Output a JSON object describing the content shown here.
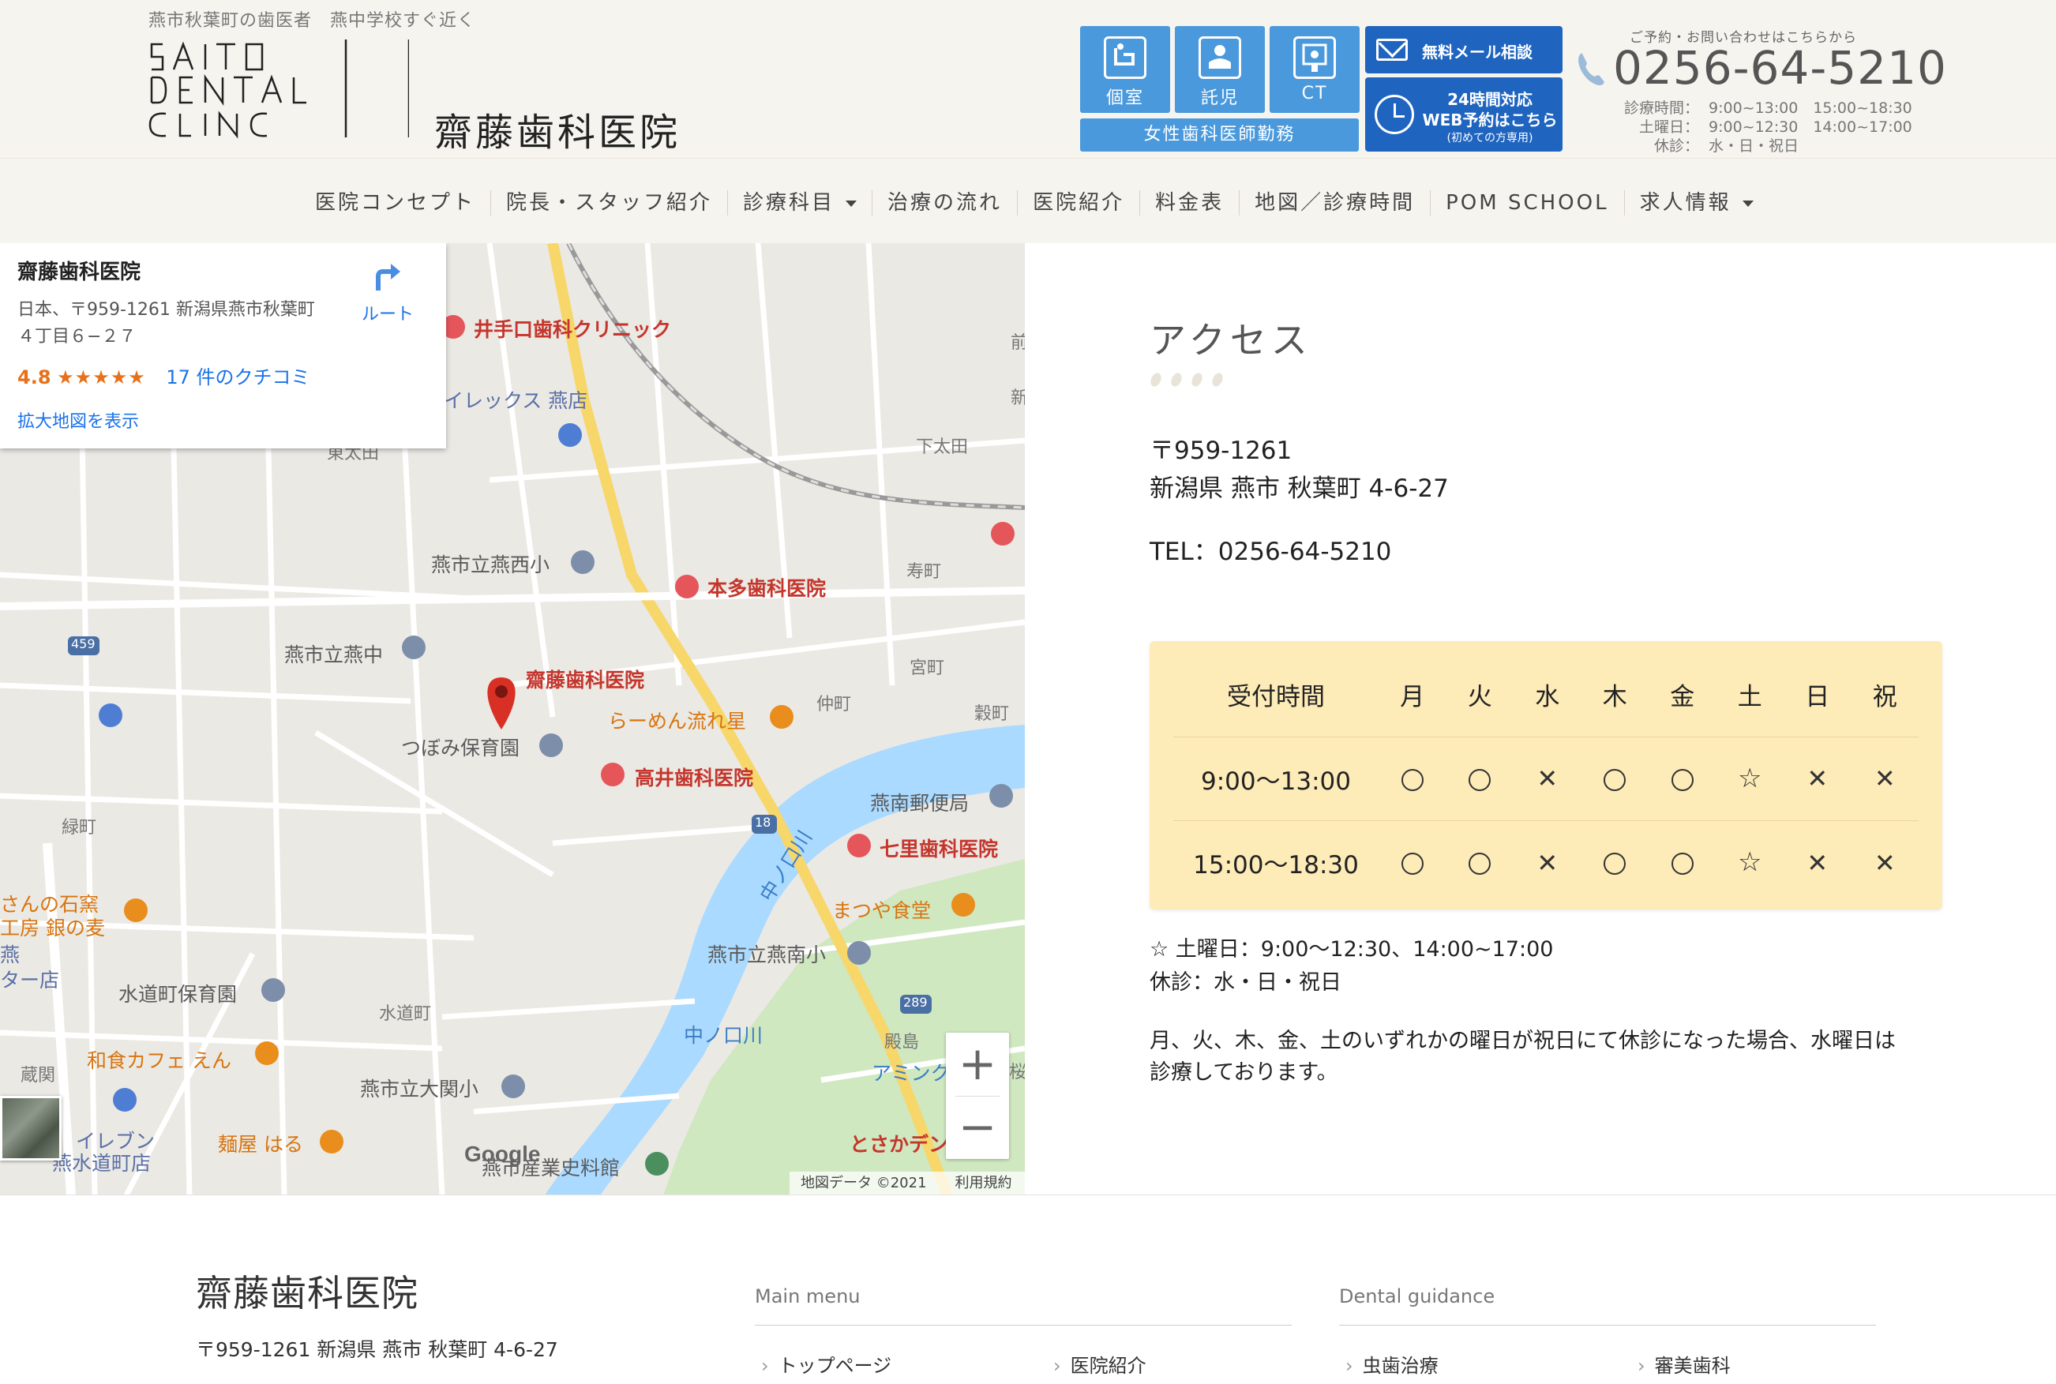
{
  "header": {
    "tagline": "燕市秋葉町の歯医者　燕中学校すぐ近く",
    "logo_name": "齋藤歯科医院",
    "features": [
      {
        "label": "個室",
        "icon": "private-room-icon"
      },
      {
        "label": "託児",
        "icon": "childcare-icon"
      },
      {
        "label": "CT",
        "icon": "ct-scanner-icon"
      }
    ],
    "female_doctor": "女性歯科医師勤務",
    "mail_button": "無料メール相談",
    "web_button": {
      "line1": "24時間対応",
      "line2": "WEB予約はこちら",
      "line3": "(初めての方専用)"
    },
    "contact_lead": "ご予約・お問い合わせはこちらから",
    "phone": "0256-64-5210",
    "hours": [
      {
        "label": "診療時間：",
        "value": "9:00~13:00　15:00~18:30"
      },
      {
        "label": "土曜日：",
        "value": "9:00~12:30　14:00~17:00"
      },
      {
        "label": "休診：",
        "value": "水・日・祝日"
      }
    ]
  },
  "nav": {
    "items": [
      {
        "label": "医院コンセプト",
        "dropdown": false
      },
      {
        "label": "院長・スタッフ紹介",
        "dropdown": false
      },
      {
        "label": "診療科目",
        "dropdown": true
      },
      {
        "label": "治療の流れ",
        "dropdown": false
      },
      {
        "label": "医院紹介",
        "dropdown": false
      },
      {
        "label": "料金表",
        "dropdown": false
      },
      {
        "label": "地図／診療時間",
        "dropdown": false
      },
      {
        "label": "POM SCHOOL",
        "dropdown": false
      },
      {
        "label": "求人情報",
        "dropdown": true
      }
    ]
  },
  "map": {
    "card": {
      "name": "齋藤歯科医院",
      "address_line1": "日本、〒959-1261 新潟県燕市秋葉町",
      "address_line2": "４丁目６−２７",
      "route": "ルート",
      "rating": "4.8",
      "stars": "★★★★★",
      "reviews": "17 件のクチコミ",
      "enlarge": "拡大地図を表示"
    },
    "labels": {
      "ideguchi": "井手口歯科クリニック",
      "ilex": "イレックス 燕店",
      "higashiota": "東太田",
      "shimoota": "下太田",
      "tsubamenishi": "燕市立燕西小",
      "honda": "本多歯科医院",
      "kotobuki": "寿町",
      "tsubamechu": "燕市立燕中",
      "saito": "齋藤歯科医院",
      "miyamachi": "宮町",
      "ramen": "らーめん流れ星",
      "nakamachi": "仲町",
      "kokumachi": "穀町",
      "tsubomi": "つぼみ保育園",
      "takai": "高井歯科医院",
      "post": "燕南郵便局",
      "midori": "緑町",
      "nanasato": "七里歯科医院",
      "nakanokuchi": "中ノ口川",
      "stone1": "さんの石窯",
      "stone2": "工房 銀の麦",
      "tsubame1": "燕",
      "tsubame2": "ター店",
      "matsuya": "まつや食堂",
      "tsubameminami": "燕市立燕南小",
      "suido_hoiku": "水道町保育園",
      "suidomachi": "水道町",
      "nakanokuchi2": "中ノ口川",
      "kurasekai": "蔵関",
      "cafe": "和食カフェ えん",
      "ooseki": "燕市立大関小",
      "denshima": "殿島",
      "amin": "アミンク",
      "seven1": "イレブン",
      "seven2": "燕水道町店",
      "haru": "麺屋 はる",
      "tosaka": "とさかデン",
      "museum": "燕市産業史料館",
      "route459": "459",
      "route18": "18",
      "route289": "289",
      "mae": "前",
      "shin": "新",
      "sakura": "桜"
    },
    "zoom_in": "+",
    "zoom_out": "−",
    "google": "Google",
    "attribution": "地図データ ©2021　　利用規約"
  },
  "access": {
    "title": "アクセス",
    "postal": "〒959-1261",
    "address": "新潟県 燕市 秋葉町 4-6-27",
    "tel": "TEL：0256-64-5210",
    "schedule": {
      "header": [
        "受付時間",
        "月",
        "火",
        "水",
        "木",
        "金",
        "土",
        "日",
        "祝"
      ],
      "rows": [
        {
          "time": "9:00〜13:00",
          "marks": [
            "o",
            "o",
            "x",
            "o",
            "o",
            "s",
            "x",
            "x"
          ]
        },
        {
          "time": "15:00〜18:30",
          "marks": [
            "o",
            "o",
            "x",
            "o",
            "o",
            "s",
            "x",
            "x"
          ]
        }
      ]
    },
    "saturday_note": "☆ 土曜日：9:00〜12:30、14:00~17:00",
    "closed_note": "休診：水・日・祝日",
    "holiday_note_line1": "月、火、木、金、土のいずれかの曜日が祝日にて休診になった場合、水曜日は",
    "holiday_note_line2": "診療しております。"
  },
  "footer": {
    "name": "齋藤歯科医院",
    "address": "〒959-1261 新潟県 燕市 秋葉町 4-6-27",
    "main_menu": "Main menu",
    "dental_guidance": "Dental guidance",
    "main_items": [
      "トップページ",
      "医院紹介"
    ],
    "dental_items": [
      "虫歯治療",
      "審美歯科"
    ]
  },
  "colors": {
    "header_bg": "#f6f4ef",
    "feature_blue": "#4a99dc",
    "button_blue": "#1f65c0",
    "schedule_bg": "#fdebb8",
    "map_red": "#c4362d",
    "map_road_yellow": "#f7d66a",
    "map_river": "#aadaff"
  }
}
